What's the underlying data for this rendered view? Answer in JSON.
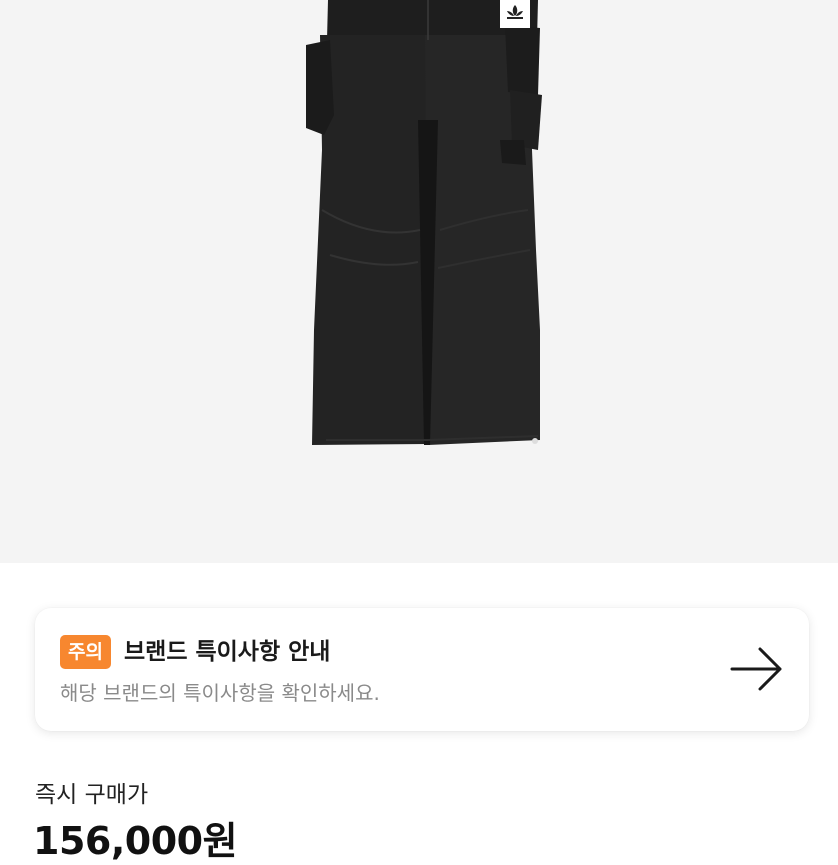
{
  "product": {
    "image_icon": "cargo-pants-product-photo",
    "logo_icon": "trefoil-logo-icon"
  },
  "notice": {
    "badge": "주의",
    "title": "브랜드 특이사항 안내",
    "description": "해당 브랜드의 특이사항을 확인하세요.",
    "arrow_icon": "arrow-right-icon",
    "badge_color": "#f7872f"
  },
  "price": {
    "label": "즉시 구매가",
    "value": "156,000원"
  }
}
